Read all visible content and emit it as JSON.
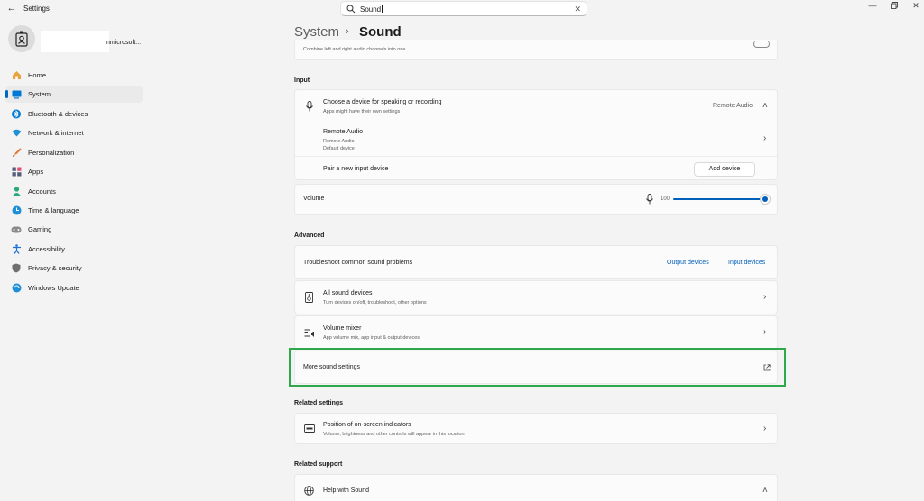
{
  "window": {
    "title": "Settings",
    "back_icon": "back-arrow-icon",
    "controls": [
      "minimize-icon",
      "restore-icon",
      "close-icon"
    ]
  },
  "search": {
    "value": "Sound",
    "clear": "✕"
  },
  "account": {
    "email": "nmicrosoft..."
  },
  "sidebar": {
    "items": [
      {
        "label": "Home",
        "icon": "home-icon",
        "color": "#e8a33d"
      },
      {
        "label": "System",
        "icon": "monitor-icon",
        "color": "#0078d4",
        "active": true
      },
      {
        "label": "Bluetooth & devices",
        "icon": "bluetooth-icon",
        "color": "#0078d4"
      },
      {
        "label": "Network & internet",
        "icon": "wifi-icon",
        "color": "#1e90d8"
      },
      {
        "label": "Personalization",
        "icon": "brush-icon",
        "color": "#e07b39"
      },
      {
        "label": "Apps",
        "icon": "apps-icon",
        "color": "#555e7a"
      },
      {
        "label": "Accounts",
        "icon": "person-icon",
        "color": "#2aa876"
      },
      {
        "label": "Time & language",
        "icon": "globe-clock-icon",
        "color": "#1e90d8"
      },
      {
        "label": "Gaming",
        "icon": "gamepad-icon",
        "color": "#7a7a7a"
      },
      {
        "label": "Accessibility",
        "icon": "accessibility-icon",
        "color": "#1e6fd8"
      },
      {
        "label": "Privacy & security",
        "icon": "shield-icon",
        "color": "#6e6e6e"
      },
      {
        "label": "Windows Update",
        "icon": "update-icon",
        "color": "#1e90d8"
      }
    ]
  },
  "breadcrumb": {
    "parent": "System",
    "separator": "›",
    "current": "Sound"
  },
  "top_card": {
    "subtitle": "Combine left and right audio channels into one"
  },
  "input": {
    "heading": "Input",
    "choose": {
      "title": "Choose a device for speaking or recording",
      "subtitle": "Apps might have their own settings",
      "value": "Remote Audio"
    },
    "device": {
      "name": "Remote Audio",
      "line1": "Remote Audio",
      "line2": "Default device"
    },
    "pair": {
      "title": "Pair a new input device",
      "button": "Add device"
    },
    "volume": {
      "label": "Volume",
      "value": "100",
      "level": 1.0
    }
  },
  "advanced": {
    "heading": "Advanced",
    "troubleshoot": {
      "title": "Troubleshoot common sound problems",
      "link1": "Output devices",
      "link2": "Input devices"
    },
    "all_devices": {
      "title": "All sound devices",
      "subtitle": "Turn devices on/off, troubleshoot, other options"
    },
    "mixer": {
      "title": "Volume mixer",
      "subtitle": "App volume mix, app input & output devices"
    },
    "more": {
      "title": "More sound settings"
    }
  },
  "related_settings": {
    "heading": "Related settings",
    "osd": {
      "title": "Position of on-screen indicators",
      "subtitle": "Volume, brightness and other controls will appear in this location"
    }
  },
  "related_support": {
    "heading": "Related support",
    "help": {
      "title": "Help with Sound"
    }
  },
  "colors": {
    "accent": "#005fb8",
    "highlight": "#2ea84a"
  }
}
